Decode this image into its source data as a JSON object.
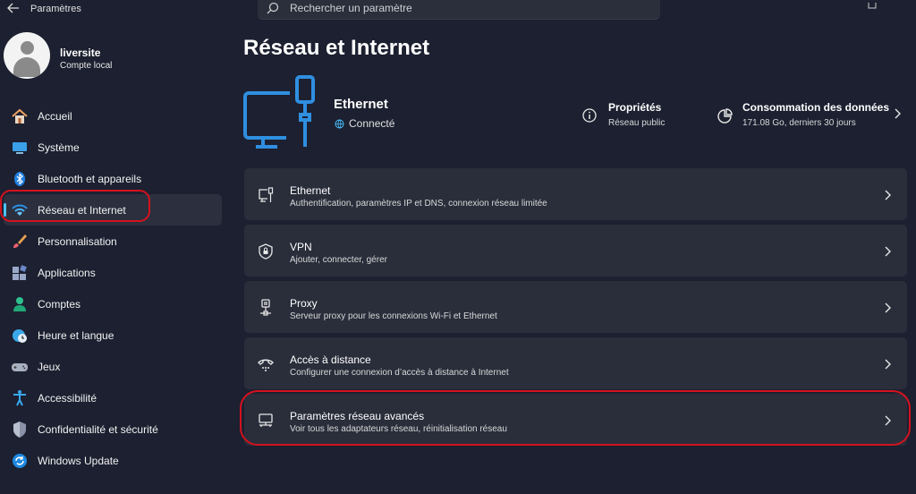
{
  "window": {
    "app_title": "Paramètres",
    "search_placeholder": "Rechercher un paramètre"
  },
  "profile": {
    "name": "liversite",
    "account_type": "Compte local"
  },
  "sidebar": {
    "selected_index": 3,
    "items": [
      {
        "label": "Accueil",
        "icon": "home-icon"
      },
      {
        "label": "Système",
        "icon": "monitor-icon"
      },
      {
        "label": "Bluetooth et appareils",
        "icon": "bluetooth-icon"
      },
      {
        "label": "Réseau et Internet",
        "icon": "wifi-icon"
      },
      {
        "label": "Personnalisation",
        "icon": "brush-icon"
      },
      {
        "label": "Applications",
        "icon": "apps-icon"
      },
      {
        "label": "Comptes",
        "icon": "person-icon"
      },
      {
        "label": "Heure et langue",
        "icon": "globe-clock-icon"
      },
      {
        "label": "Jeux",
        "icon": "gamepad-icon"
      },
      {
        "label": "Accessibilité",
        "icon": "accessibility-icon"
      },
      {
        "label": "Confidentialité et sécurité",
        "icon": "shield-icon"
      },
      {
        "label": "Windows Update",
        "icon": "update-icon"
      }
    ]
  },
  "main": {
    "title": "Réseau et Internet",
    "hero": {
      "name": "Ethernet",
      "status": "Connecté",
      "icon": "ethernet-monitor-icon"
    },
    "properties": {
      "title": "Propriétés",
      "subtitle": "Réseau public",
      "icon": "info-icon"
    },
    "data_usage": {
      "title": "Consommation des données",
      "subtitle": "171.08 Go, derniers 30 jours",
      "icon": "data-usage-icon"
    },
    "cards": [
      {
        "title": "Ethernet",
        "subtitle": "Authentification, paramètres IP et DNS, connexion réseau limitée",
        "icon": "ethernet-icon"
      },
      {
        "title": "VPN",
        "subtitle": "Ajouter, connecter, gérer",
        "icon": "vpn-shield-icon"
      },
      {
        "title": "Proxy",
        "subtitle": "Serveur proxy pour les connexions Wi-Fi et Ethernet",
        "icon": "proxy-icon"
      },
      {
        "title": "Accès à distance",
        "subtitle": "Configurer une connexion d’accès à distance à Internet",
        "icon": "dialup-icon"
      },
      {
        "title": "Paramètres réseau avancés",
        "subtitle": "Voir tous les adaptateurs réseau, réinitialisation réseau",
        "icon": "network-adapter-icon"
      }
    ]
  },
  "colors": {
    "accent": "#4cc2ff",
    "annotation": "#d4121e",
    "background": "#1c2030",
    "card": "#2a2e3b"
  }
}
